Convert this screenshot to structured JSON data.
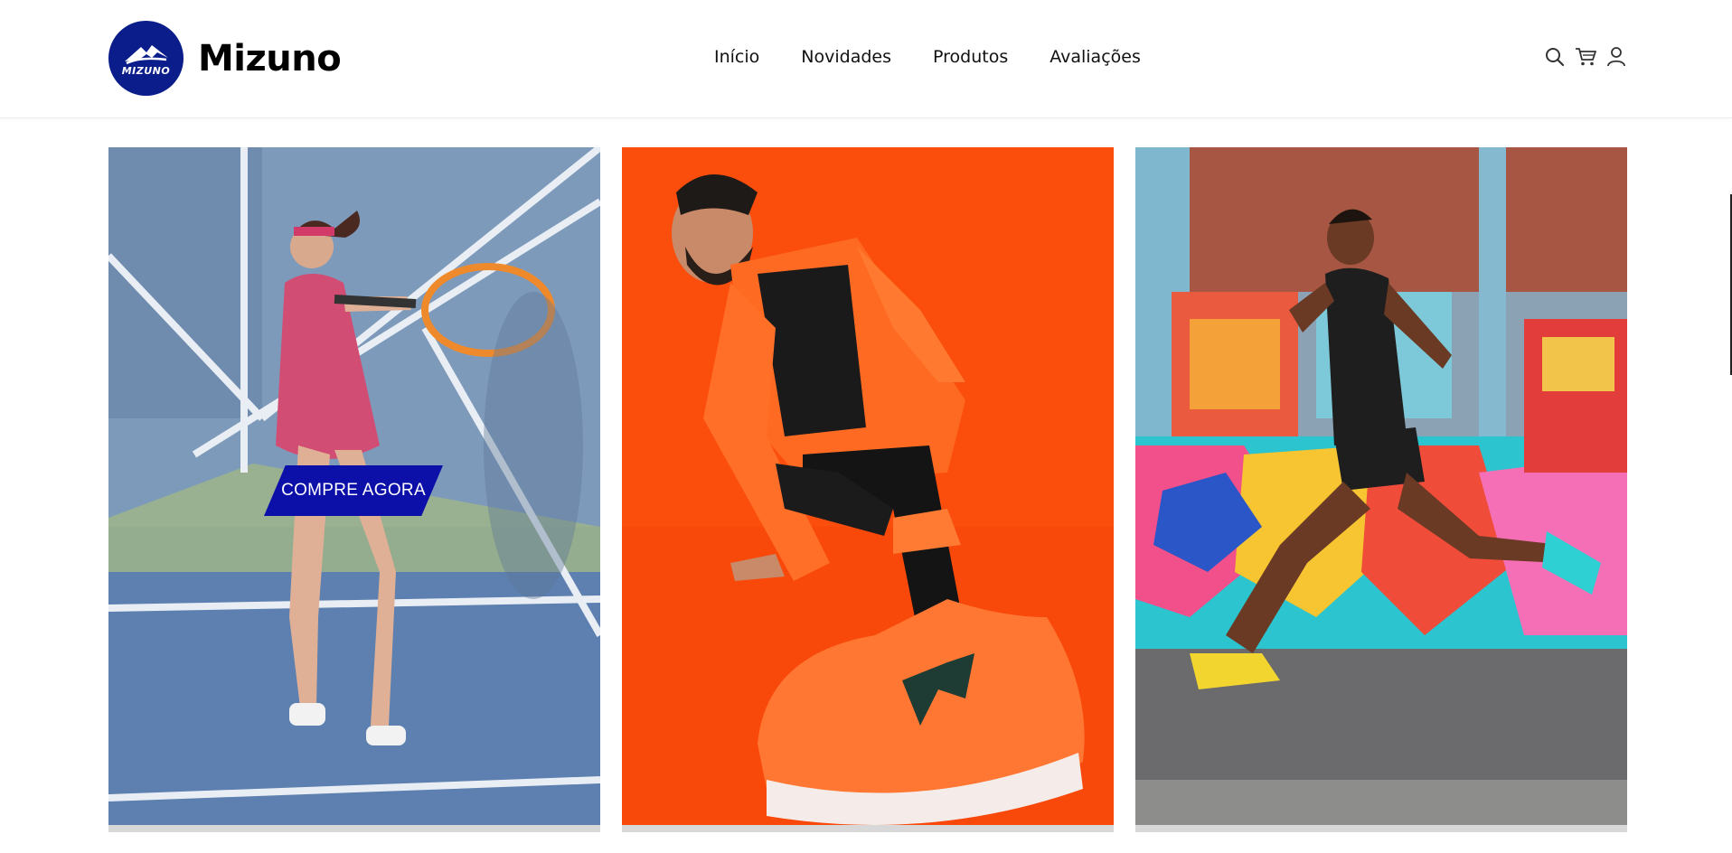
{
  "header": {
    "brand_name": "Mizuno",
    "logo_text": "MIZUNO",
    "nav": [
      {
        "label": "Início"
      },
      {
        "label": "Novidades"
      },
      {
        "label": "Produtos"
      },
      {
        "label": "Avaliações"
      }
    ],
    "icons": [
      "search-icon",
      "cart-icon",
      "user-icon"
    ]
  },
  "cards": [
    {
      "subject": "tennis",
      "cta_label": "COMPRE AGORA"
    },
    {
      "subject": "running-shoe"
    },
    {
      "subject": "runner"
    }
  ],
  "colors": {
    "brand_blue": "#0a1d8a",
    "cta_blue": "#0c0fa8",
    "orange": "#fb4e0d"
  }
}
